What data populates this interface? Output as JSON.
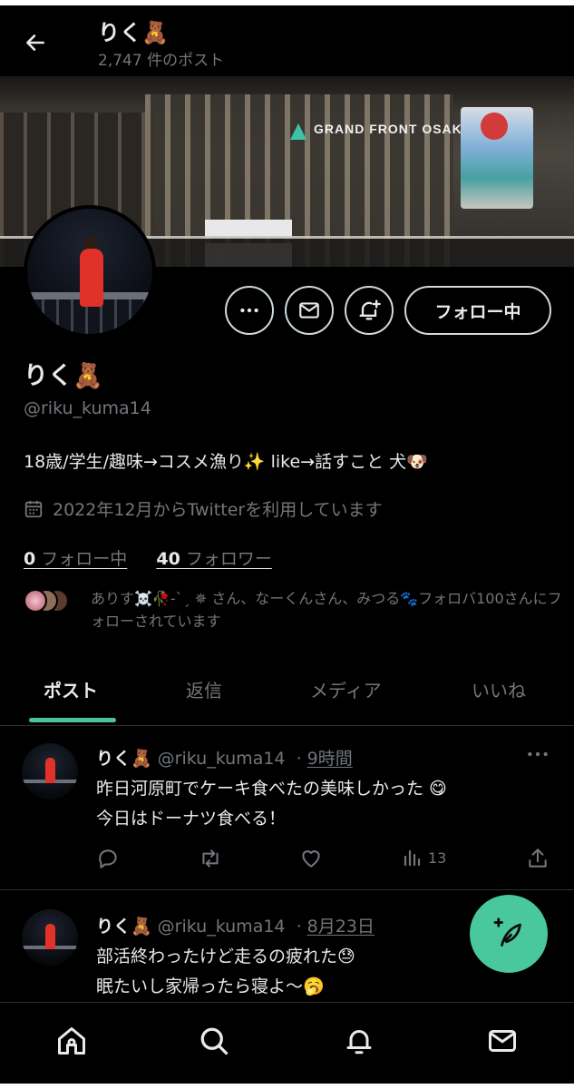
{
  "header": {
    "name": "りく🧸",
    "post_count": "2,747 件のポスト"
  },
  "banner": {
    "sign_text": "GRAND FRONT OSAKA"
  },
  "actions": {
    "follow_label": "フォロー中"
  },
  "profile": {
    "display_name": "りく🧸",
    "handle": "@riku_kuma14",
    "bio": "18歳/学生/趣味→コスメ漁り✨ like→話すこと 犬🐶",
    "joined": "2022年12月からTwitterを利用しています",
    "following_count": "0",
    "following_label": "フォロー中",
    "followers_count": "40",
    "followers_label": "フォロワー",
    "known_followers_text": "ありす☠️🥀-ˋˏ ✵ さん、なーくんさん、みつる🐾フォロバ100さんにフォローされています"
  },
  "tabs": [
    {
      "label": "ポスト",
      "active": true
    },
    {
      "label": "返信",
      "active": false
    },
    {
      "label": "メディア",
      "active": false
    },
    {
      "label": "いいね",
      "active": false
    }
  ],
  "tweets": [
    {
      "name": "りく🧸",
      "handle": "@riku_kuma14",
      "separator": "·",
      "time": "9時間",
      "line1": "昨日河原町でケーキ食べたの美味しかった 😋",
      "line2": "今日はドーナツ食べる！",
      "views": "13"
    },
    {
      "name": "りく🧸",
      "handle": "@riku_kuma14",
      "separator": "·",
      "time": "8月23日",
      "line1": "部活終わったけど走るの疲れた😓",
      "line2": "眠たいし家帰ったら寝よ〜🥱"
    }
  ],
  "colors": {
    "accent": "#48c89c",
    "text_primary": "#e7e9ea",
    "text_secondary": "#71767b",
    "divider": "#2f3336"
  },
  "icons": {
    "back": "arrow-left-icon",
    "more": "more-horizontal-icon",
    "message": "envelope-icon",
    "notify": "bell-plus-icon",
    "calendar": "calendar-icon",
    "reply": "reply-icon",
    "repost": "repost-icon",
    "like": "heart-icon",
    "views": "bar-chart-icon",
    "share": "share-icon",
    "compose": "feather-plus-icon",
    "home": "home-icon",
    "search": "search-icon",
    "notifications": "bell-icon",
    "messages": "envelope-icon"
  }
}
